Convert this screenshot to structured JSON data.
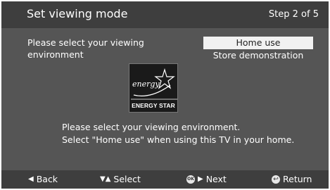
{
  "header": {
    "title": "Set viewing mode",
    "step": "Step 2 of 5"
  },
  "prompt": {
    "line1": "Please select your viewing",
    "line2": "environment"
  },
  "options": [
    {
      "label": "Home use",
      "selected": true
    },
    {
      "label": "Store demonstration",
      "selected": false
    }
  ],
  "energy_logo": {
    "script": "energy",
    "label": "ENERGY STAR"
  },
  "description": {
    "line1": "Please select your viewing environment.",
    "line2": "Select \"Home use\" when using this TV in your home."
  },
  "footer": {
    "back": {
      "icon": "left-triangle-icon",
      "label": "Back"
    },
    "select": {
      "icon": "up-down-arrows-icon",
      "label": "Select"
    },
    "next": {
      "icon": "ok-button-icon",
      "badge": "OK",
      "label": "Next"
    },
    "return": {
      "icon": "return-icon",
      "label": "Return"
    }
  },
  "colors": {
    "panel": "#555555",
    "bars": "#3e3e3e",
    "selected_bg": "#f2f2f2",
    "text": "#ffffff"
  }
}
